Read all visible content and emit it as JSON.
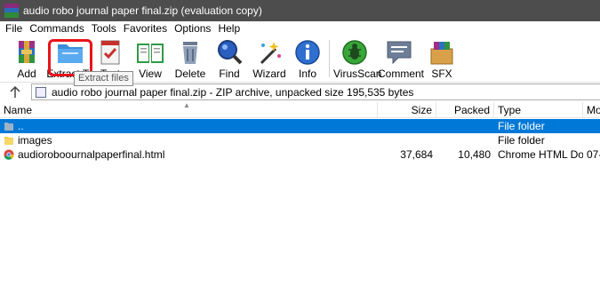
{
  "window": {
    "title": "audio robo journal paper final.zip (evaluation copy)"
  },
  "menu": [
    "File",
    "Commands",
    "Tools",
    "Favorites",
    "Options",
    "Help"
  ],
  "toolbar": {
    "buttons": [
      {
        "label": "Add",
        "icon": "add-archive-icon"
      },
      {
        "label": "Extract To",
        "icon": "extract-folder-icon"
      },
      {
        "label": "Test",
        "icon": "test-icon"
      },
      {
        "label": "View",
        "icon": "view-book-icon"
      },
      {
        "label": "Delete",
        "icon": "trash-icon"
      },
      {
        "label": "Find",
        "icon": "magnifier-icon"
      },
      {
        "label": "Wizard",
        "icon": "wand-icon"
      },
      {
        "label": "Info",
        "icon": "info-icon"
      },
      {
        "label": "VirusScan",
        "icon": "bug-shield-icon"
      },
      {
        "label": "Comment",
        "icon": "comment-icon"
      },
      {
        "label": "SFX",
        "icon": "sfx-box-icon"
      }
    ],
    "tooltip": "Extract files",
    "highlight_color": "#e8141b"
  },
  "address": {
    "text": "audio robo journal paper final.zip - ZIP archive, unpacked size 195,535 bytes"
  },
  "filelist": {
    "columns": [
      "Name",
      "Size",
      "Packed",
      "Type",
      "Mo"
    ],
    "rows": [
      {
        "name": "..",
        "size": "",
        "packed": "",
        "type": "File folder",
        "modified": "",
        "icon": "parent-folder-icon",
        "selected": true
      },
      {
        "name": "images",
        "size": "",
        "packed": "",
        "type": "File folder",
        "modified": "",
        "icon": "folder-icon",
        "selected": false
      },
      {
        "name": "audioroboournalpaperfinal.html",
        "size": "37,684",
        "packed": "10,480",
        "type": "Chrome HTML Doc...",
        "modified": "07-",
        "icon": "chrome-icon",
        "selected": false
      }
    ]
  },
  "colors": {
    "selection": "#0078d7",
    "titlebar": "#4d4d4d"
  }
}
